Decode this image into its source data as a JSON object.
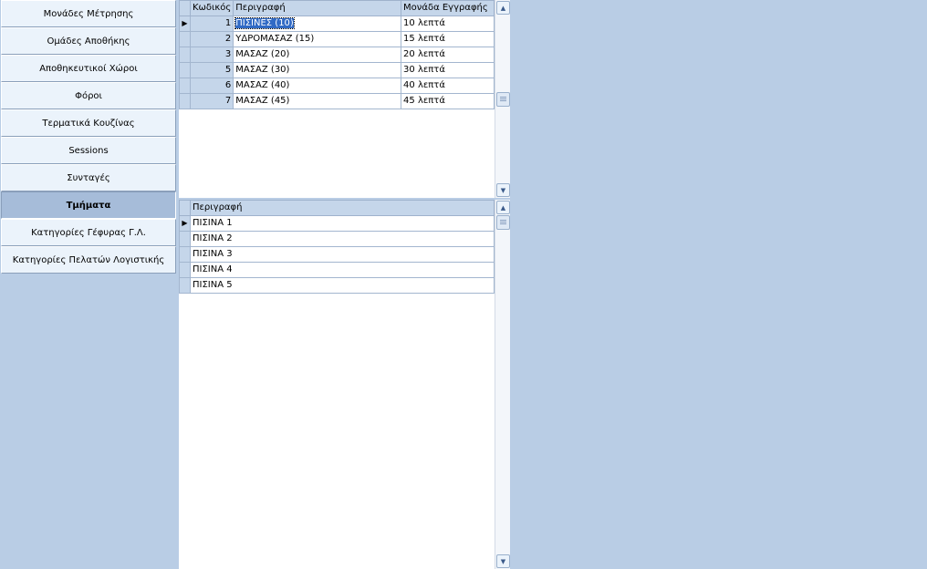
{
  "nav": {
    "items": [
      {
        "label": "Μονάδες Μέτρησης"
      },
      {
        "label": "Ομάδες Αποθήκης"
      },
      {
        "label": "Αποθηκευτικοί Χώροι"
      },
      {
        "label": "Φόροι"
      },
      {
        "label": "Τερματικά Κουζίνας"
      },
      {
        "label": "Sessions"
      },
      {
        "label": "Συνταγές"
      },
      {
        "label": "Τμήματα"
      },
      {
        "label": "Κατηγορίες Γέφυρας Γ.Λ."
      },
      {
        "label": "Κατηγορίες Πελατών Λογιστικής"
      }
    ],
    "active": "Τμήματα"
  },
  "top_grid": {
    "columns": [
      "Κωδικός",
      "Περιγραφή",
      "Μονάδα Εγγραφής"
    ],
    "rows": [
      {
        "code": "1",
        "desc": "ΠΙΣΙΝΕΣ (10)",
        "unit": "10 λεπτά"
      },
      {
        "code": "2",
        "desc": "ΥΔΡΟΜΑΣΑΖ (15)",
        "unit": "15 λεπτά"
      },
      {
        "code": "3",
        "desc": "ΜΑΣΑΖ (20)",
        "unit": "20 λεπτά"
      },
      {
        "code": "5",
        "desc": "ΜΑΣΑΖ (30)",
        "unit": "30 λεπτά"
      },
      {
        "code": "6",
        "desc": "ΜΑΣΑΖ (40)",
        "unit": "40 λεπτά"
      },
      {
        "code": "7",
        "desc": "ΜΑΣΑΖ (45)",
        "unit": "45 λεπτά"
      }
    ],
    "current_row_marker": "▶"
  },
  "bottom_grid": {
    "columns": [
      "Περιγραφή"
    ],
    "rows": [
      {
        "desc": "ΠΙΣΙΝΑ 1"
      },
      {
        "desc": "ΠΙΣΙΝΑ 2"
      },
      {
        "desc": "ΠΙΣΙΝΑ 3"
      },
      {
        "desc": "ΠΙΣΙΝΑ 4"
      },
      {
        "desc": "ΠΙΣΙΝΑ 5"
      }
    ],
    "current_row_marker": "▶"
  },
  "scroll": {
    "up": "▲",
    "down": "▼"
  },
  "colors": {
    "background": "#b9cde5",
    "selection": "#316ac5",
    "header": "#c5d6ea"
  }
}
